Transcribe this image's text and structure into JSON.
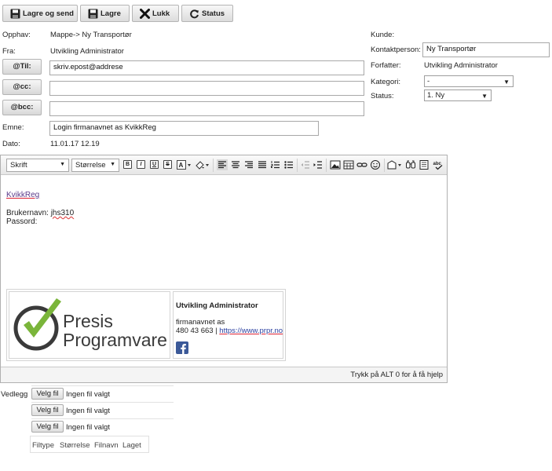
{
  "toolbar": {
    "save_send_label": "Lagre og send",
    "save_label": "Lagre",
    "close_label": "Lukk",
    "status_label": "Status"
  },
  "header": {
    "origin_label": "Opphav:",
    "origin_value": "Mappe-> Ny Transportør",
    "from_label": "Fra:",
    "from_value": "Utvikling Administrator",
    "to_button": "@Til:",
    "to_value": "skriv.epost@addrese",
    "cc_button": "@cc:",
    "cc_value": "",
    "bcc_button": "@bcc:",
    "bcc_value": "",
    "subject_label": "Emne:",
    "subject_value": "Login firmanavnet as KvikkReg",
    "date_label": "Dato:",
    "date_value": "11.01.17 12.19"
  },
  "side": {
    "customer_label": "Kunde:",
    "customer_value": "",
    "contact_label": "Kontaktperson:",
    "contact_value": "Ny Transportør",
    "author_label": "Forfatter:",
    "author_value": "Utvikling Administrator",
    "category_label": "Kategori:",
    "category_value": "-",
    "status_label": "Status:",
    "status_value": "1. Ny"
  },
  "editor": {
    "font_combo": "Skrift",
    "size_combo": "Størrelse",
    "link_text": "KvikkReg",
    "username_label": "Brukernavn:",
    "username_value": "jhs310",
    "password_label": "Passord:",
    "help_text": "Trykk på ALT 0 for å få hjelp"
  },
  "signature": {
    "logo_word1": "Presis",
    "logo_word2": "Programvare",
    "name": "Utvikling Administrator",
    "company": "firmanavnet as",
    "phone": "480 43 663 |",
    "url": "https://www.prpr.no",
    "accent": "#7ab53a",
    "facebook_color": "#3b5998"
  },
  "attachments": {
    "label": "Vedlegg",
    "choose_label": "Velg fil",
    "no_file_label": "Ingen fil valgt",
    "columns": [
      "Filtype",
      "Størrelse",
      "Filnavn",
      "Laget"
    ]
  }
}
